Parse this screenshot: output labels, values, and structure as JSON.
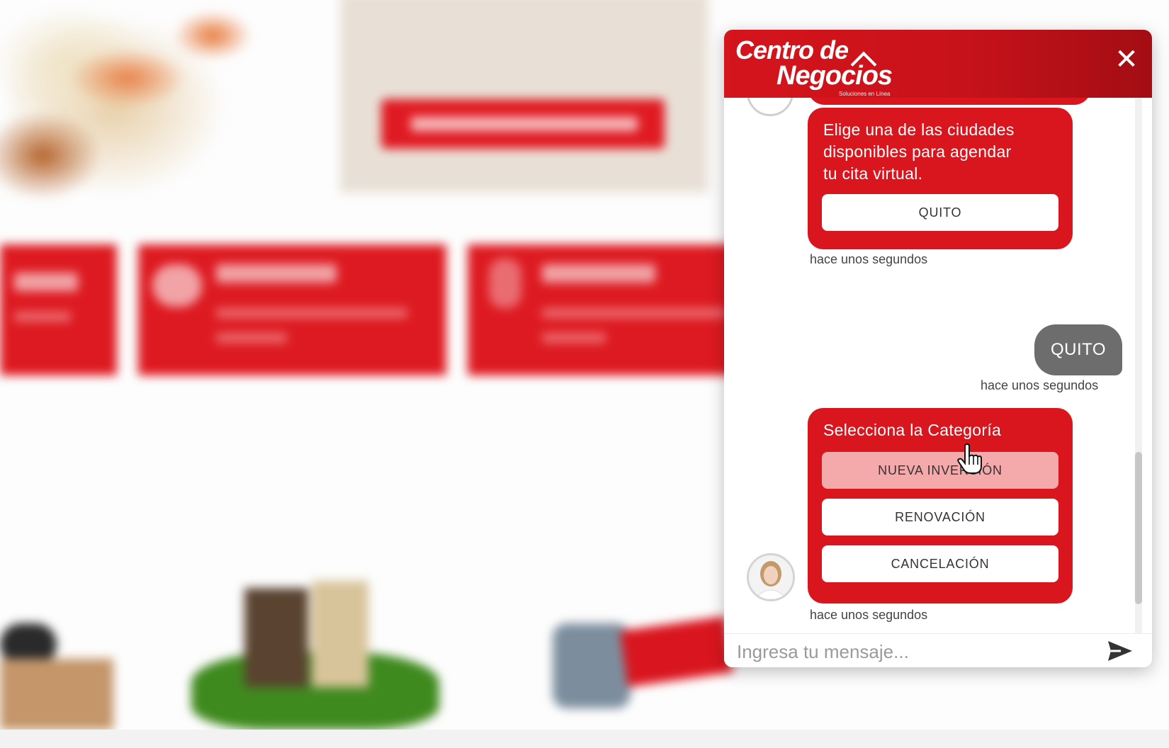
{
  "colors": {
    "brand_red": "#d9151e",
    "user_bubble": "#6d6d6d",
    "option_hover": "#f4a9ab"
  },
  "widget": {
    "logo_line1": "Centro de",
    "logo_line2": "Negocios",
    "logo_tagline": "Soluciones en Línea",
    "close_icon": "close-icon",
    "close_glyph": "✕"
  },
  "messages": {
    "bot_cities": {
      "text_lines": [
        "Elige una de las ciudades",
        "disponibles para agendar",
        "tu cita virtual."
      ],
      "option": "QUITO",
      "timestamp": "hace unos segundos"
    },
    "user_reply": {
      "text": "QUITO",
      "timestamp": "hace unos segundos"
    },
    "bot_category": {
      "title": "Selecciona la Categoría",
      "options": [
        "NUEVA INVERSIÓN",
        "RENOVACIÓN",
        "CANCELACIÓN"
      ],
      "hovered_option": "NUEVA INVERSIÓN",
      "timestamp": "hace unos segundos"
    }
  },
  "composer": {
    "placeholder": "Ingresa tu mensaje...",
    "send_icon": "send-icon"
  }
}
